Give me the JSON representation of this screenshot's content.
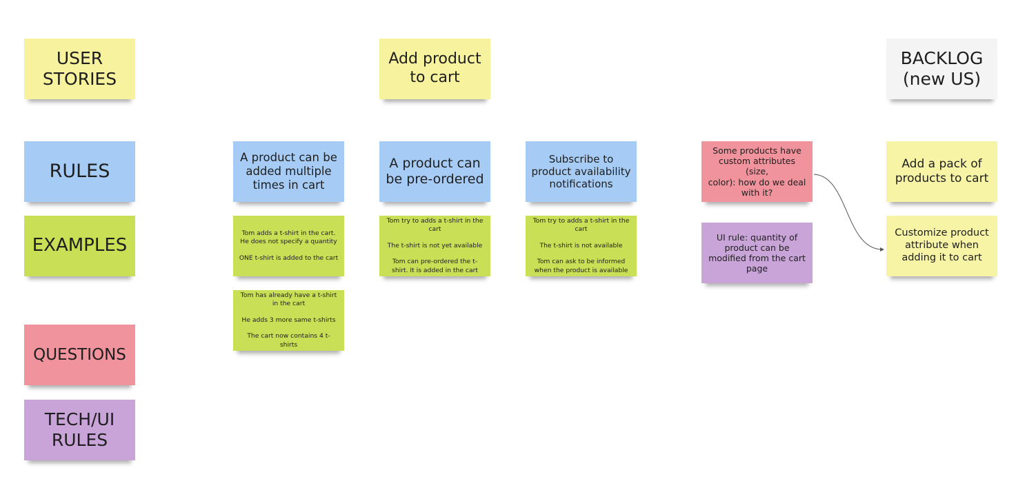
{
  "board": {
    "legend": [
      {
        "id": "user-stories",
        "label": "USER\nSTORIES",
        "color": "#f6f29d"
      },
      {
        "id": "rules",
        "label": "RULES",
        "color": "#a6ccf5"
      },
      {
        "id": "examples",
        "label": "EXAMPLES",
        "color": "#c9df56"
      },
      {
        "id": "questions",
        "label": "QUESTIONS",
        "color": "#f1939c"
      },
      {
        "id": "tech-ui-rules",
        "label": "TECH/UI\nRULES",
        "color": "#c9a4d9"
      }
    ],
    "user_story": {
      "label": "Add product\nto cart"
    },
    "backlog_header": {
      "label": "BACKLOG\n(new US)"
    },
    "rules": [
      {
        "label": "A product can be\nadded multiple\ntimes in cart",
        "examples": [
          {
            "lines": [
              "Tom adds a t-shirt in the cart. He does not specify a quantity",
              "ONE t-shirt is added to the cart"
            ]
          },
          {
            "lines": [
              "Tom has already have a t-shirt in the cart",
              "He adds 3 more same t-shirts",
              "The cart now contains 4 t-shirts"
            ]
          }
        ]
      },
      {
        "label": "A product can\nbe pre-ordered",
        "examples": [
          {
            "lines": [
              "Tom try to adds a t-shirt in the cart",
              "The t-shirt is not yet available",
              "Tom can pre-ordered the t-shirt. It is added in the cart"
            ]
          }
        ]
      },
      {
        "label": "Subscribe to\nproduct availability\nnotifications",
        "examples": [
          {
            "lines": [
              "Tom try to adds a t-shirt in the cart",
              "The t-shirt is not available",
              "Tom can ask to be informed when the product is available"
            ]
          }
        ]
      }
    ],
    "question": {
      "label": "Some products have\ncustom attributes (size,\ncolor): how do we deal\nwith it?"
    },
    "tech_rule": {
      "label": "UI rule: quantity of\nproduct can be\nmodified from the cart\npage"
    },
    "backlog_items": [
      {
        "label": "Add a pack of\nproducts to cart"
      },
      {
        "label": "Customize product\nattribute when\nadding it to cart"
      }
    ],
    "connector": {
      "from": "question",
      "to": "backlog_items.1",
      "style": "curved-arrow"
    }
  }
}
